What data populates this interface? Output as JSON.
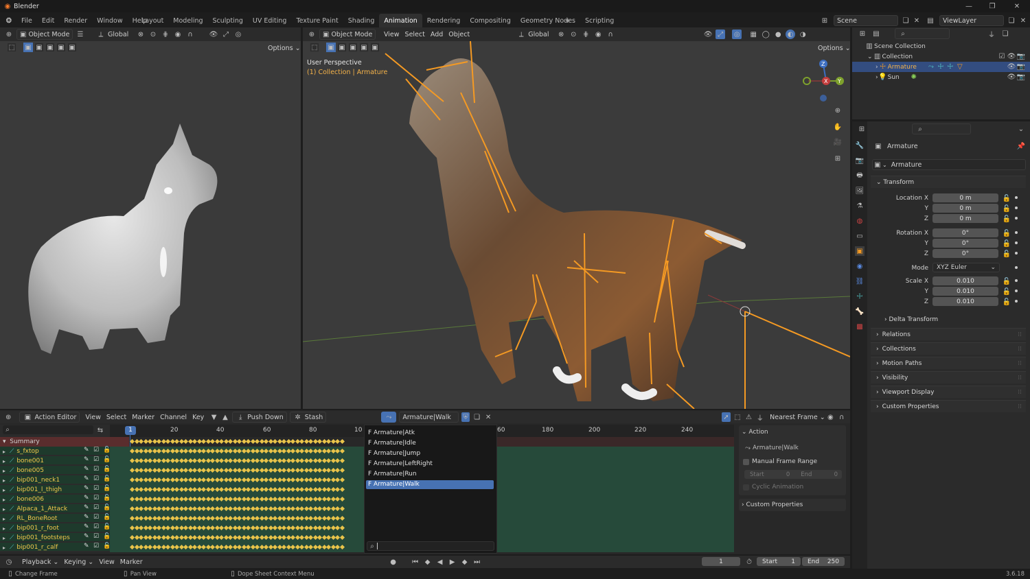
{
  "titlebar": {
    "app": "Blender"
  },
  "menu": [
    "File",
    "Edit",
    "Render",
    "Window",
    "Help"
  ],
  "workspaces": [
    "Layout",
    "Modeling",
    "Sculpting",
    "UV Editing",
    "Texture Paint",
    "Shading",
    "Animation",
    "Rendering",
    "Compositing",
    "Geometry Nodes",
    "Scripting"
  ],
  "active_workspace": "Animation",
  "scene": "Scene",
  "viewlayer": "ViewLayer",
  "vp_left": {
    "mode": "Object Mode",
    "orient": "Global",
    "options": "Options"
  },
  "vp_main": {
    "mode": "Object Mode",
    "menus": [
      "View",
      "Select",
      "Add",
      "Object"
    ],
    "orient": "Global",
    "options": "Options",
    "perspective": "User Perspective",
    "collection": "(1) Collection | Armature"
  },
  "outliner": {
    "scene_collection": "Scene Collection",
    "collection": "Collection",
    "armature": "Armature",
    "sun": "Sun"
  },
  "properties": {
    "object": "Armature",
    "data": "Armature",
    "transform": "Transform",
    "loc_label": "Location X",
    "y": "Y",
    "z": "Z",
    "zero_m": "0 m",
    "rot_label": "Rotation X",
    "zero_deg": "0°",
    "mode_label": "Mode",
    "mode": "XYZ Euler",
    "scale_label": "Scale X",
    "scale": "0.010",
    "delta": "Delta Transform",
    "sections": [
      "Relations",
      "Collections",
      "Motion Paths",
      "Visibility",
      "Viewport Display",
      "Custom Properties"
    ]
  },
  "dopesheet": {
    "editor": "Action Editor",
    "menus": [
      "View",
      "Select",
      "Marker",
      "Channel",
      "Key"
    ],
    "push_down": "Push Down",
    "stash": "Stash",
    "action": "Armature|Walk",
    "snap": "Nearest Frame",
    "frame_marker": "1",
    "ticks_left": [
      "20",
      "40",
      "60",
      "80",
      "10"
    ],
    "ticks_right": [
      "60",
      "180",
      "200",
      "220",
      "240"
    ],
    "summary": "Summary",
    "channels": [
      "s_fxtop",
      "bone001",
      "bone005",
      "bip001_neck1",
      "bip001_l_thigh",
      "bone006",
      "Alpaca_1_Attack",
      "RL_BoneRoot",
      "bip001_r_foot",
      "bip001_footsteps",
      "bip001_r_calf"
    ],
    "actions": [
      "F Armature|Atk",
      "F Armature|Idle",
      "F Armature|Jump",
      "F Armature|LeftRight",
      "F Armature|Run",
      "F Armature|Walk"
    ],
    "side": {
      "action": "Action",
      "action_name": "Armature|Walk",
      "manual": "Manual Frame Range",
      "start": "Start",
      "start_v": "0",
      "end": "End",
      "end_v": "0",
      "cyclic": "Cyclic Animation",
      "custom": "Custom Properties"
    }
  },
  "timeline": {
    "menus": [
      "Playback",
      "Keying",
      "View",
      "Marker"
    ],
    "frame": "1",
    "start_label": "Start",
    "start": "1",
    "end_label": "End",
    "end": "250"
  },
  "status": {
    "left": "Change Frame",
    "mid": "Pan View",
    "ctx": "Dope Sheet Context Menu",
    "version": "3.6.18"
  },
  "colors": {
    "accent": "#4772b3",
    "orange": "#f59a23",
    "key": "#e8c34a"
  }
}
